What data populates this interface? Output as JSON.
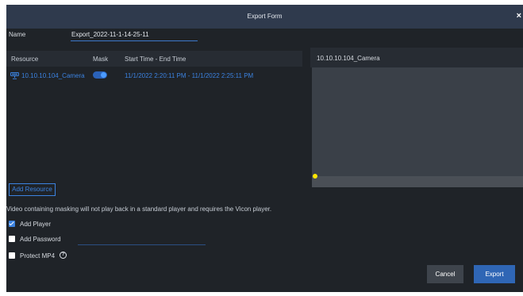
{
  "dialog": {
    "title": "Export Form",
    "close_glyph": "×"
  },
  "name_field": {
    "label": "Name",
    "value": "Export_2022-11-1-14-25-11"
  },
  "resource_table": {
    "columns": [
      "Resource",
      "Mask",
      "Start Time - End Time"
    ],
    "rows": [
      {
        "icon": "camera-icon",
        "resource": "10.10.10.104_Camera",
        "mask_enabled": true,
        "time_range": "11/1/2022 2:20:11 PM - 11/1/2022 2:25:11 PM"
      }
    ]
  },
  "preview": {
    "title": "10.10.10.104_Camera"
  },
  "add_resource_label": "Add Resource",
  "warning_text": "Video containing masking will not play back in a standard player and requires the Vicon player.",
  "options": {
    "add_player": {
      "label": "Add Player",
      "checked": true
    },
    "add_password": {
      "label": "Add Password",
      "checked": false
    },
    "protect_mp4": {
      "label": "Protect MP4",
      "checked": false,
      "help_glyph": "?"
    }
  },
  "buttons": {
    "cancel": "Cancel",
    "export": "Export"
  },
  "colors": {
    "titlebar": "#2f3a4d",
    "dialog_bg": "#1f2328",
    "accent": "#3b82e0",
    "timeline_marker": "#ffe600"
  }
}
